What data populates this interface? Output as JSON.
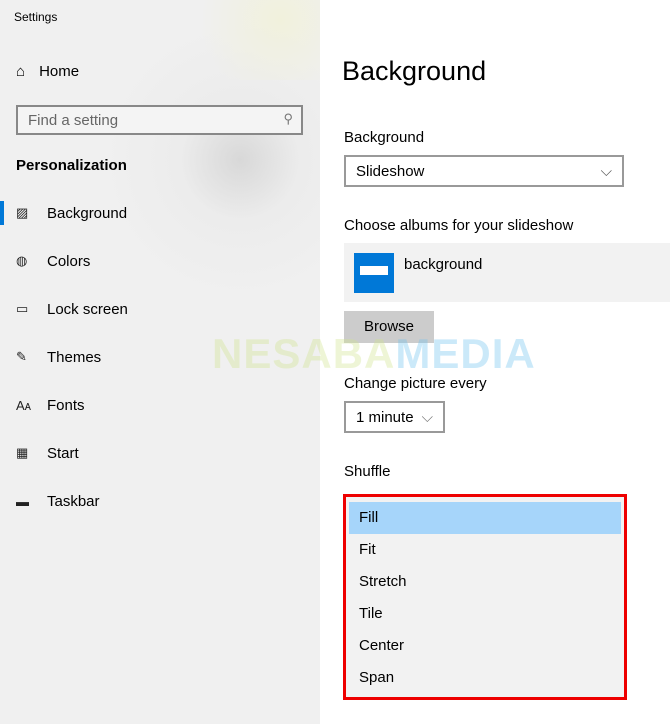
{
  "window_title": "Settings",
  "sidebar": {
    "home": "Home",
    "search_placeholder": "Find a setting",
    "section": "Personalization",
    "items": [
      {
        "label": "Background",
        "icon": "picture-icon",
        "selected": true
      },
      {
        "label": "Colors",
        "icon": "palette-icon"
      },
      {
        "label": "Lock screen",
        "icon": "lock-screen-icon"
      },
      {
        "label": "Themes",
        "icon": "themes-icon"
      },
      {
        "label": "Fonts",
        "icon": "fonts-icon"
      },
      {
        "label": "Start",
        "icon": "start-icon"
      },
      {
        "label": "Taskbar",
        "icon": "taskbar-icon"
      }
    ]
  },
  "main": {
    "title": "Background",
    "background_label": "Background",
    "background_value": "Slideshow",
    "albums_label": "Choose albums for your slideshow",
    "album_name": "background",
    "browse": "Browse",
    "change_label": "Change picture every",
    "change_value": "1 minute",
    "shuffle_label": "Shuffle",
    "fit_options": [
      "Fill",
      "Fit",
      "Stretch",
      "Tile",
      "Center",
      "Span"
    ],
    "fit_highlighted": "Fill"
  },
  "watermark": {
    "part1": "NESABA",
    "part2": "MEDIA"
  },
  "colors": {
    "accent": "#0078d7",
    "highlight": "#a6d5fa",
    "outline": "#e00000"
  }
}
